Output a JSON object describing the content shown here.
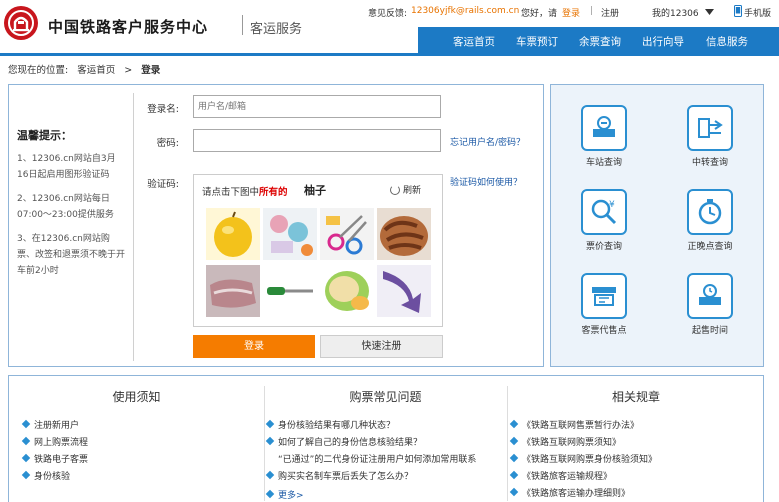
{
  "header": {
    "title": "中国铁路客户服务中心",
    "subtitle": "客运服务",
    "feedback_label": "意见反馈:",
    "feedback_email": "12306yjfk@rails.com.cn",
    "greeting": "您好，请",
    "login_link": "登录",
    "sep": "|",
    "register_link": "注册",
    "my12306": "我的12306",
    "mobile": "手机版",
    "colors": {
      "nav_blue": "#1c7ac5",
      "brand_red": "#c8161d",
      "accent_orange": "#f57c00"
    }
  },
  "nav": [
    {
      "label": "客运首页"
    },
    {
      "label": "车票预订"
    },
    {
      "label": "余票查询"
    },
    {
      "label": "出行向导"
    },
    {
      "label": "信息服务"
    }
  ],
  "breadcrumb": {
    "prefix": "您现在的位置:",
    "home": "客运首页",
    "arrow": ">",
    "current": "登录"
  },
  "tips": {
    "title": "温馨提示：",
    "items": [
      "1、12306.cn网站自3月16日起启用图形验证码",
      "2、12306.cn网站每日07:00～23:00提供服务",
      "3、在12306.cn网站购票、改签和退票须不晚于开车前2小时"
    ]
  },
  "form": {
    "username_label": "登录名:",
    "username_placeholder": "用户名/邮箱",
    "password_label": "密码:",
    "forgot_link": "忘记用户名/密码？",
    "captcha_label": "验证码:",
    "captcha_help_link": "验证码如何使用？",
    "captcha_prompt_prefix": "请点击下图中",
    "captcha_prompt_emph": "所有的",
    "captcha_target": "柚子",
    "refresh_label": "刷新",
    "login_button": "登录",
    "register_button": "快速注册"
  },
  "captcha_tiles": [
    {
      "icon": "pomelo-image"
    },
    {
      "icon": "craft-items-image"
    },
    {
      "icon": "scissors-image"
    },
    {
      "icon": "shrimp-dish-image"
    },
    {
      "icon": "meat-image"
    },
    {
      "icon": "screwdriver-image"
    },
    {
      "icon": "pomelo-cut-image"
    },
    {
      "icon": "arrow-image"
    }
  ],
  "services": [
    {
      "label": "车站查询",
      "icon": "station-icon"
    },
    {
      "label": "中转查询",
      "icon": "transfer-icon"
    },
    {
      "label": "票价查询",
      "icon": "fare-search-icon"
    },
    {
      "label": "正晚点查询",
      "icon": "clock-icon"
    },
    {
      "label": "客票代售点",
      "icon": "ticket-agent-icon"
    },
    {
      "label": "起售时间",
      "icon": "sale-time-icon"
    }
  ],
  "bottom": {
    "col1": {
      "title": "使用须知",
      "items": [
        "注册新用户",
        "网上购票流程",
        "铁路电子客票",
        "身份核验"
      ]
    },
    "col2": {
      "title": "购票常见问题",
      "items": [
        "身份核验结果有哪几种状态？",
        "如何了解自己的身份信息核验结果？",
        "“已通过”的二代身份证注册用户如何添加常用联系",
        "购买实名制车票后丢失了怎么办？"
      ],
      "more": "更多>"
    },
    "col3": {
      "title": "相关规章",
      "items": [
        "《铁路互联网售票暂行办法》",
        "《铁路互联网购票须知》",
        "《铁路互联网购票身份核验须知》",
        "《铁路旅客运输规程》",
        "《铁路旅客运输办理细则》"
      ]
    }
  }
}
